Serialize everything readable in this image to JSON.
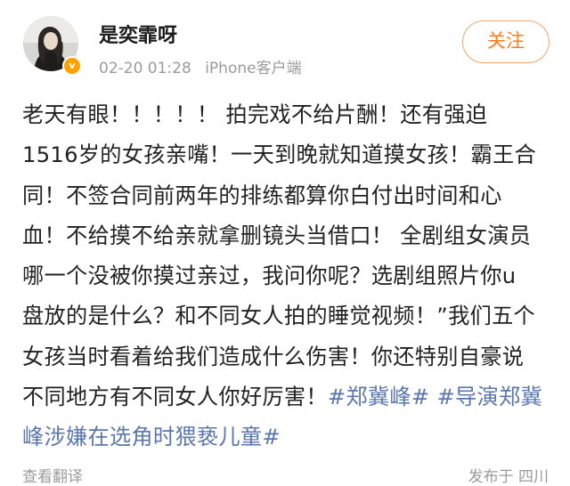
{
  "post": {
    "author": {
      "name": "是奕霏呀",
      "avatar_icon": "avatar-photo",
      "verified_icon": "verified-badge-icon",
      "verified_color": "#ffa200",
      "verified_glyph": "v"
    },
    "date": "02-20 01:28",
    "client": "iPhone客户端",
    "follow_label": "关注",
    "accent_color": "#ff7a1a",
    "hashtag_color": "#5b77ad",
    "lines": [
      "老天有眼！！！！！ 拍完戏不给片酬！还有强迫",
      "1516岁的女孩亲嘴！一天到晚就知道摸女孩！霸王合",
      "同！不签合同前两年的排练都算你白付出时间和心",
      "血！不给摸不给亲就拿删镜头当借口！ 全剧组女演员",
      "哪一个没被你摸过亲过，我问你呢？选剧组照片你u",
      "盘放的是什么？和不同女人拍的睡觉视频！”我们五个"
    ],
    "line7_text": "女孩当时看着给我们造成什么伤害！你还特别自豪说",
    "line8_text": "不同地方有不同女人你好厉害！",
    "hashtags": [
      "#郑冀峰#",
      "#导演郑冀",
      "峰涉嫌在选角时猥亵儿童#"
    ],
    "translate_label": "查看翻译",
    "location_label": "发布于 四川"
  }
}
